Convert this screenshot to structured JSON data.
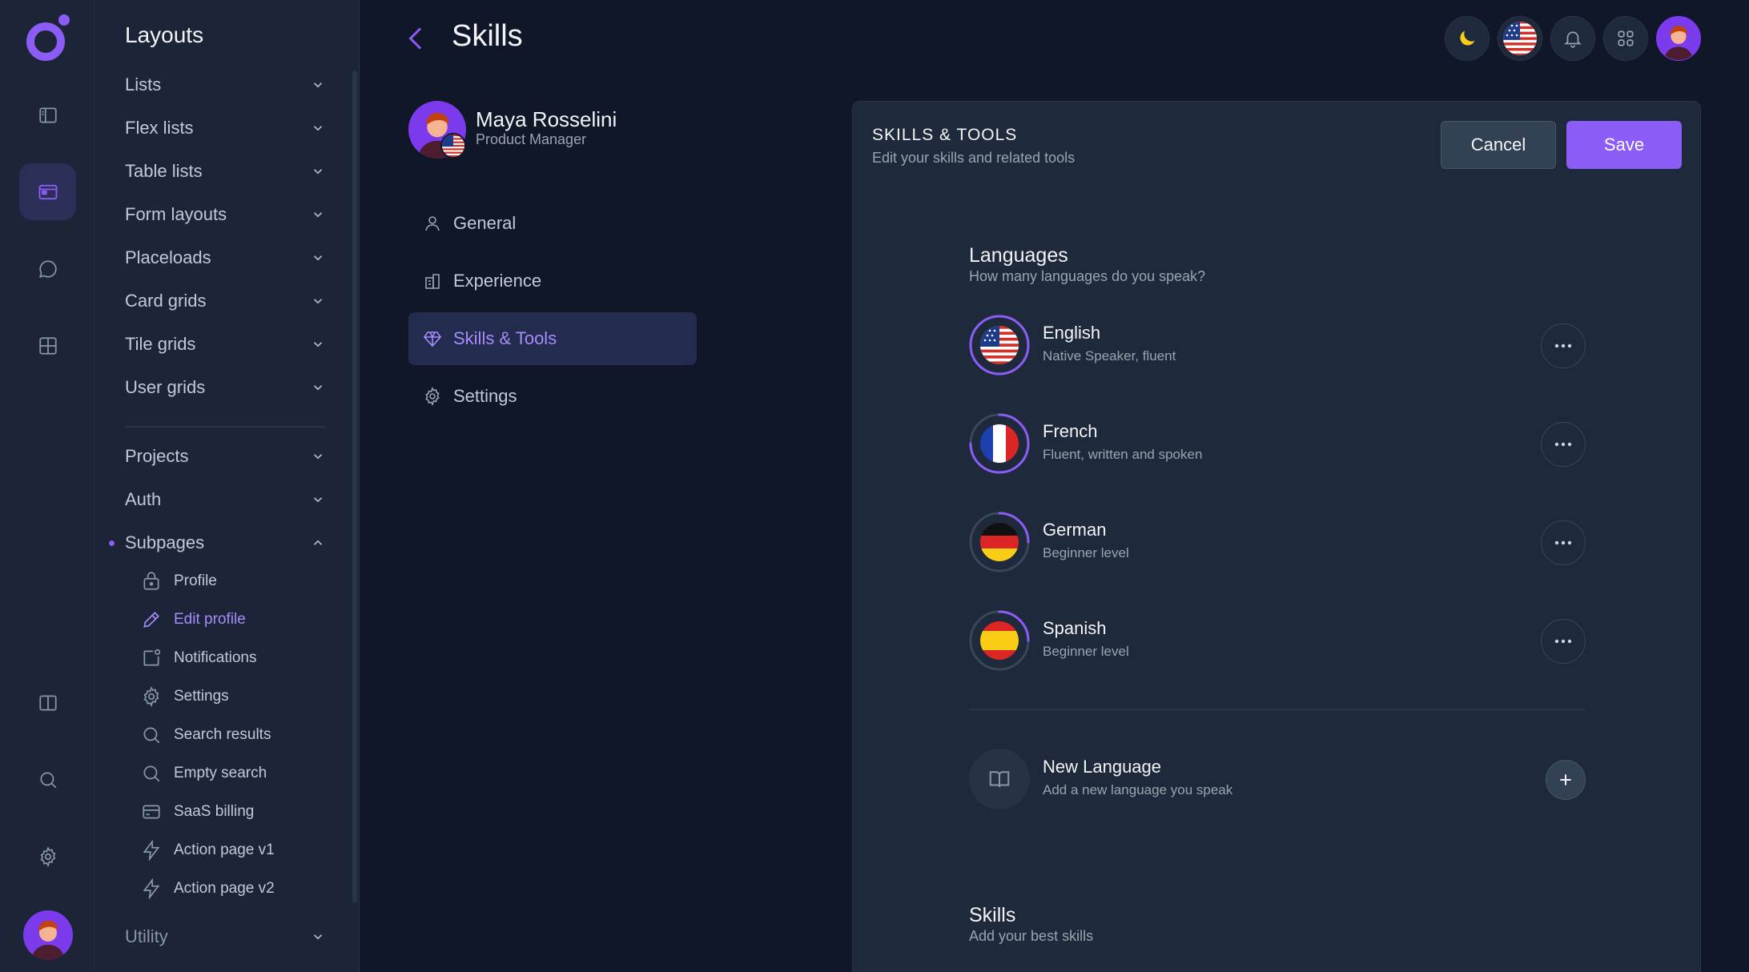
{
  "sidebar": {
    "title": "Layouts",
    "items": [
      {
        "label": "Lists"
      },
      {
        "label": "Flex lists"
      },
      {
        "label": "Table lists"
      },
      {
        "label": "Form layouts"
      },
      {
        "label": "Placeloads"
      },
      {
        "label": "Card grids"
      },
      {
        "label": "Tile grids"
      },
      {
        "label": "User grids"
      },
      {
        "label": "Projects"
      },
      {
        "label": "Auth"
      },
      {
        "label": "Subpages"
      },
      {
        "label": "Utility"
      }
    ],
    "subitems": [
      {
        "label": "Profile",
        "icon": "lock-icon"
      },
      {
        "label": "Edit profile",
        "icon": "pencil-icon"
      },
      {
        "label": "Notifications",
        "icon": "notification-icon"
      },
      {
        "label": "Settings",
        "icon": "gear-icon"
      },
      {
        "label": "Search results",
        "icon": "search-icon"
      },
      {
        "label": "Empty search",
        "icon": "search-icon"
      },
      {
        "label": "SaaS billing",
        "icon": "credit-card-icon"
      },
      {
        "label": "Action page v1",
        "icon": "lightning-icon"
      },
      {
        "label": "Action page v2",
        "icon": "lightning-icon"
      }
    ]
  },
  "header": {
    "title": "Skills"
  },
  "profile": {
    "name": "Maya Rosselini",
    "role": "Product Manager"
  },
  "profile_nav": [
    {
      "label": "General",
      "icon": "user-icon"
    },
    {
      "label": "Experience",
      "icon": "building-icon"
    },
    {
      "label": "Skills & Tools",
      "icon": "diamond-icon"
    },
    {
      "label": "Settings",
      "icon": "gear-icon"
    }
  ],
  "card": {
    "title": "SKILLS & TOOLS",
    "subtitle": "Edit your skills and related tools",
    "cancel_label": "Cancel",
    "save_label": "Save"
  },
  "languages": {
    "title": "Languages",
    "subtitle": "How many languages do you speak?",
    "items": [
      {
        "name": "English",
        "level": "Native Speaker, fluent",
        "flag": "us-flag-icon",
        "progress": 1.0
      },
      {
        "name": "French",
        "level": "Fluent, written and spoken",
        "flag": "fr-flag-icon",
        "progress": 0.75
      },
      {
        "name": "German",
        "level": "Beginner level",
        "flag": "de-flag-icon",
        "progress": 0.25
      },
      {
        "name": "Spanish",
        "level": "Beginner level",
        "flag": "es-flag-icon",
        "progress": 0.25
      }
    ],
    "new_title": "New Language",
    "new_subtitle": "Add a new language you speak"
  },
  "skills": {
    "title": "Skills",
    "subtitle": "Add your best skills"
  },
  "colors": {
    "accent": "#8b5cf6",
    "background": "#0f1729",
    "panel": "#1b2537",
    "card": "#1e293b"
  }
}
